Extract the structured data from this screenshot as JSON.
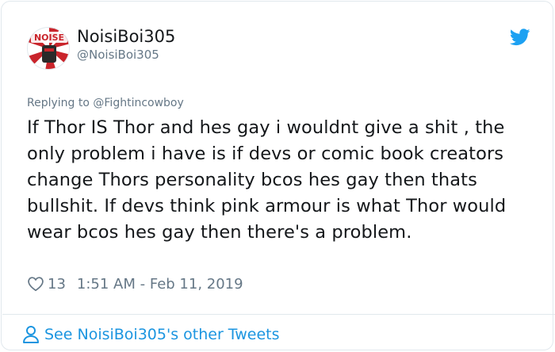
{
  "tweet": {
    "author": {
      "display_name": "NoisiBoi305",
      "handle": "@NoisiBoi305",
      "avatar_text": "NOISE"
    },
    "reply_prefix": "Replying to",
    "reply_to": "@Fightincowboy",
    "text": "If Thor IS Thor and hes gay i wouldnt give a shit , the only problem i have is if devs or comic book creators change Thors personality bcos hes gay then thats bullshit. If devs think pink armour is what Thor would wear bcos hes gay then there's a problem.",
    "likes": "13",
    "timestamp": "1:51 AM - Feb 11, 2019",
    "footer_link": "See NoisiBoi305's other Tweets"
  },
  "colors": {
    "twitter_blue": "#1da1f2",
    "link_blue": "#1b95e0",
    "secondary_text": "#657786",
    "border": "#e1e8ed"
  },
  "icons": [
    "twitter-bird-icon",
    "heart-icon",
    "person-icon"
  ]
}
